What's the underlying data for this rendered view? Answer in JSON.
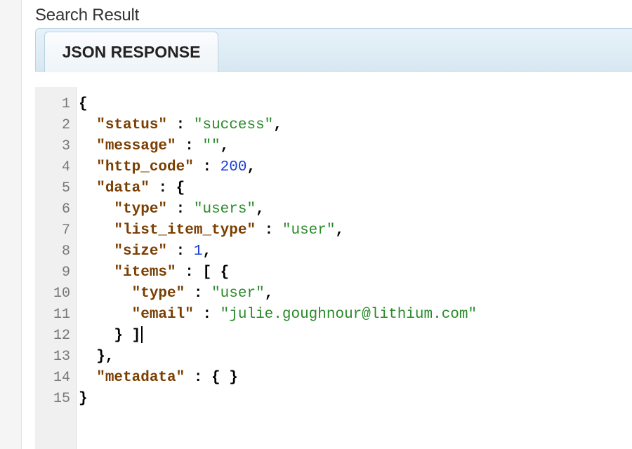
{
  "header": {
    "title": "Search Result"
  },
  "tabs": [
    {
      "label": "JSON RESPONSE",
      "active": true
    }
  ],
  "editor": {
    "lines": [
      {
        "num": "1",
        "tokens": [
          {
            "t": "p",
            "v": "{"
          }
        ]
      },
      {
        "num": "2",
        "tokens": [
          {
            "t": "p",
            "v": "  "
          },
          {
            "t": "k",
            "v": "\"status\""
          },
          {
            "t": "p",
            "v": " : "
          },
          {
            "t": "s",
            "v": "\"success\""
          },
          {
            "t": "p",
            "v": ","
          }
        ]
      },
      {
        "num": "3",
        "tokens": [
          {
            "t": "p",
            "v": "  "
          },
          {
            "t": "k",
            "v": "\"message\""
          },
          {
            "t": "p",
            "v": " : "
          },
          {
            "t": "s",
            "v": "\"\""
          },
          {
            "t": "p",
            "v": ","
          }
        ]
      },
      {
        "num": "4",
        "tokens": [
          {
            "t": "p",
            "v": "  "
          },
          {
            "t": "k",
            "v": "\"http_code\""
          },
          {
            "t": "p",
            "v": " : "
          },
          {
            "t": "n",
            "v": "200"
          },
          {
            "t": "p",
            "v": ","
          }
        ]
      },
      {
        "num": "5",
        "tokens": [
          {
            "t": "p",
            "v": "  "
          },
          {
            "t": "k",
            "v": "\"data\""
          },
          {
            "t": "p",
            "v": " : {"
          }
        ]
      },
      {
        "num": "6",
        "tokens": [
          {
            "t": "p",
            "v": "    "
          },
          {
            "t": "k",
            "v": "\"type\""
          },
          {
            "t": "p",
            "v": " : "
          },
          {
            "t": "s",
            "v": "\"users\""
          },
          {
            "t": "p",
            "v": ","
          }
        ]
      },
      {
        "num": "7",
        "tokens": [
          {
            "t": "p",
            "v": "    "
          },
          {
            "t": "k",
            "v": "\"list_item_type\""
          },
          {
            "t": "p",
            "v": " : "
          },
          {
            "t": "s",
            "v": "\"user\""
          },
          {
            "t": "p",
            "v": ","
          }
        ]
      },
      {
        "num": "8",
        "tokens": [
          {
            "t": "p",
            "v": "    "
          },
          {
            "t": "k",
            "v": "\"size\""
          },
          {
            "t": "p",
            "v": " : "
          },
          {
            "t": "n",
            "v": "1"
          },
          {
            "t": "p",
            "v": ","
          }
        ]
      },
      {
        "num": "9",
        "tokens": [
          {
            "t": "p",
            "v": "    "
          },
          {
            "t": "k",
            "v": "\"items\""
          },
          {
            "t": "p",
            "v": " : [ {"
          }
        ]
      },
      {
        "num": "10",
        "tokens": [
          {
            "t": "p",
            "v": "      "
          },
          {
            "t": "k",
            "v": "\"type\""
          },
          {
            "t": "p",
            "v": " : "
          },
          {
            "t": "s",
            "v": "\"user\""
          },
          {
            "t": "p",
            "v": ","
          }
        ]
      },
      {
        "num": "11",
        "tokens": [
          {
            "t": "p",
            "v": "      "
          },
          {
            "t": "k",
            "v": "\"email\""
          },
          {
            "t": "p",
            "v": " : "
          },
          {
            "t": "s",
            "v": "\"julie.goughnour@lithium.com\""
          }
        ]
      },
      {
        "num": "12",
        "tokens": [
          {
            "t": "p",
            "v": "    } ]"
          }
        ],
        "cursor": true
      },
      {
        "num": "13",
        "tokens": [
          {
            "t": "p",
            "v": "  },"
          }
        ]
      },
      {
        "num": "14",
        "tokens": [
          {
            "t": "p",
            "v": "  "
          },
          {
            "t": "k",
            "v": "\"metadata\""
          },
          {
            "t": "p",
            "v": " : { }"
          }
        ]
      },
      {
        "num": "15",
        "tokens": [
          {
            "t": "p",
            "v": "}"
          }
        ]
      }
    ]
  },
  "colors": {
    "key": "#7a3e00",
    "string": "#2a8a2a",
    "number": "#1a3ed8",
    "tab_bar": "#d7e8f2"
  }
}
